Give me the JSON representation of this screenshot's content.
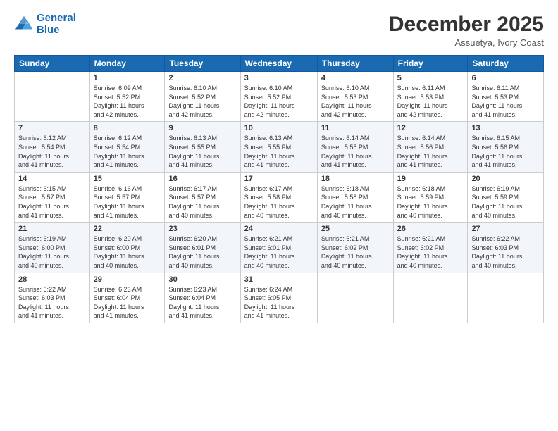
{
  "header": {
    "logo_line1": "General",
    "logo_line2": "Blue",
    "month_title": "December 2025",
    "location": "Assuetya, Ivory Coast"
  },
  "days_of_week": [
    "Sunday",
    "Monday",
    "Tuesday",
    "Wednesday",
    "Thursday",
    "Friday",
    "Saturday"
  ],
  "weeks": [
    [
      {
        "day": "",
        "content": ""
      },
      {
        "day": "1",
        "content": "Sunrise: 6:09 AM\nSunset: 5:52 PM\nDaylight: 11 hours\nand 42 minutes."
      },
      {
        "day": "2",
        "content": "Sunrise: 6:10 AM\nSunset: 5:52 PM\nDaylight: 11 hours\nand 42 minutes."
      },
      {
        "day": "3",
        "content": "Sunrise: 6:10 AM\nSunset: 5:52 PM\nDaylight: 11 hours\nand 42 minutes."
      },
      {
        "day": "4",
        "content": "Sunrise: 6:10 AM\nSunset: 5:53 PM\nDaylight: 11 hours\nand 42 minutes."
      },
      {
        "day": "5",
        "content": "Sunrise: 6:11 AM\nSunset: 5:53 PM\nDaylight: 11 hours\nand 42 minutes."
      },
      {
        "day": "6",
        "content": "Sunrise: 6:11 AM\nSunset: 5:53 PM\nDaylight: 11 hours\nand 41 minutes."
      }
    ],
    [
      {
        "day": "7",
        "content": "Sunrise: 6:12 AM\nSunset: 5:54 PM\nDaylight: 11 hours\nand 41 minutes."
      },
      {
        "day": "8",
        "content": "Sunrise: 6:12 AM\nSunset: 5:54 PM\nDaylight: 11 hours\nand 41 minutes."
      },
      {
        "day": "9",
        "content": "Sunrise: 6:13 AM\nSunset: 5:55 PM\nDaylight: 11 hours\nand 41 minutes."
      },
      {
        "day": "10",
        "content": "Sunrise: 6:13 AM\nSunset: 5:55 PM\nDaylight: 11 hours\nand 41 minutes."
      },
      {
        "day": "11",
        "content": "Sunrise: 6:14 AM\nSunset: 5:55 PM\nDaylight: 11 hours\nand 41 minutes."
      },
      {
        "day": "12",
        "content": "Sunrise: 6:14 AM\nSunset: 5:56 PM\nDaylight: 11 hours\nand 41 minutes."
      },
      {
        "day": "13",
        "content": "Sunrise: 6:15 AM\nSunset: 5:56 PM\nDaylight: 11 hours\nand 41 minutes."
      }
    ],
    [
      {
        "day": "14",
        "content": "Sunrise: 6:15 AM\nSunset: 5:57 PM\nDaylight: 11 hours\nand 41 minutes."
      },
      {
        "day": "15",
        "content": "Sunrise: 6:16 AM\nSunset: 5:57 PM\nDaylight: 11 hours\nand 41 minutes."
      },
      {
        "day": "16",
        "content": "Sunrise: 6:17 AM\nSunset: 5:57 PM\nDaylight: 11 hours\nand 40 minutes."
      },
      {
        "day": "17",
        "content": "Sunrise: 6:17 AM\nSunset: 5:58 PM\nDaylight: 11 hours\nand 40 minutes."
      },
      {
        "day": "18",
        "content": "Sunrise: 6:18 AM\nSunset: 5:58 PM\nDaylight: 11 hours\nand 40 minutes."
      },
      {
        "day": "19",
        "content": "Sunrise: 6:18 AM\nSunset: 5:59 PM\nDaylight: 11 hours\nand 40 minutes."
      },
      {
        "day": "20",
        "content": "Sunrise: 6:19 AM\nSunset: 5:59 PM\nDaylight: 11 hours\nand 40 minutes."
      }
    ],
    [
      {
        "day": "21",
        "content": "Sunrise: 6:19 AM\nSunset: 6:00 PM\nDaylight: 11 hours\nand 40 minutes."
      },
      {
        "day": "22",
        "content": "Sunrise: 6:20 AM\nSunset: 6:00 PM\nDaylight: 11 hours\nand 40 minutes."
      },
      {
        "day": "23",
        "content": "Sunrise: 6:20 AM\nSunset: 6:01 PM\nDaylight: 11 hours\nand 40 minutes."
      },
      {
        "day": "24",
        "content": "Sunrise: 6:21 AM\nSunset: 6:01 PM\nDaylight: 11 hours\nand 40 minutes."
      },
      {
        "day": "25",
        "content": "Sunrise: 6:21 AM\nSunset: 6:02 PM\nDaylight: 11 hours\nand 40 minutes."
      },
      {
        "day": "26",
        "content": "Sunrise: 6:21 AM\nSunset: 6:02 PM\nDaylight: 11 hours\nand 40 minutes."
      },
      {
        "day": "27",
        "content": "Sunrise: 6:22 AM\nSunset: 6:03 PM\nDaylight: 11 hours\nand 40 minutes."
      }
    ],
    [
      {
        "day": "28",
        "content": "Sunrise: 6:22 AM\nSunset: 6:03 PM\nDaylight: 11 hours\nand 41 minutes."
      },
      {
        "day": "29",
        "content": "Sunrise: 6:23 AM\nSunset: 6:04 PM\nDaylight: 11 hours\nand 41 minutes."
      },
      {
        "day": "30",
        "content": "Sunrise: 6:23 AM\nSunset: 6:04 PM\nDaylight: 11 hours\nand 41 minutes."
      },
      {
        "day": "31",
        "content": "Sunrise: 6:24 AM\nSunset: 6:05 PM\nDaylight: 11 hours\nand 41 minutes."
      },
      {
        "day": "",
        "content": ""
      },
      {
        "day": "",
        "content": ""
      },
      {
        "day": "",
        "content": ""
      }
    ]
  ]
}
